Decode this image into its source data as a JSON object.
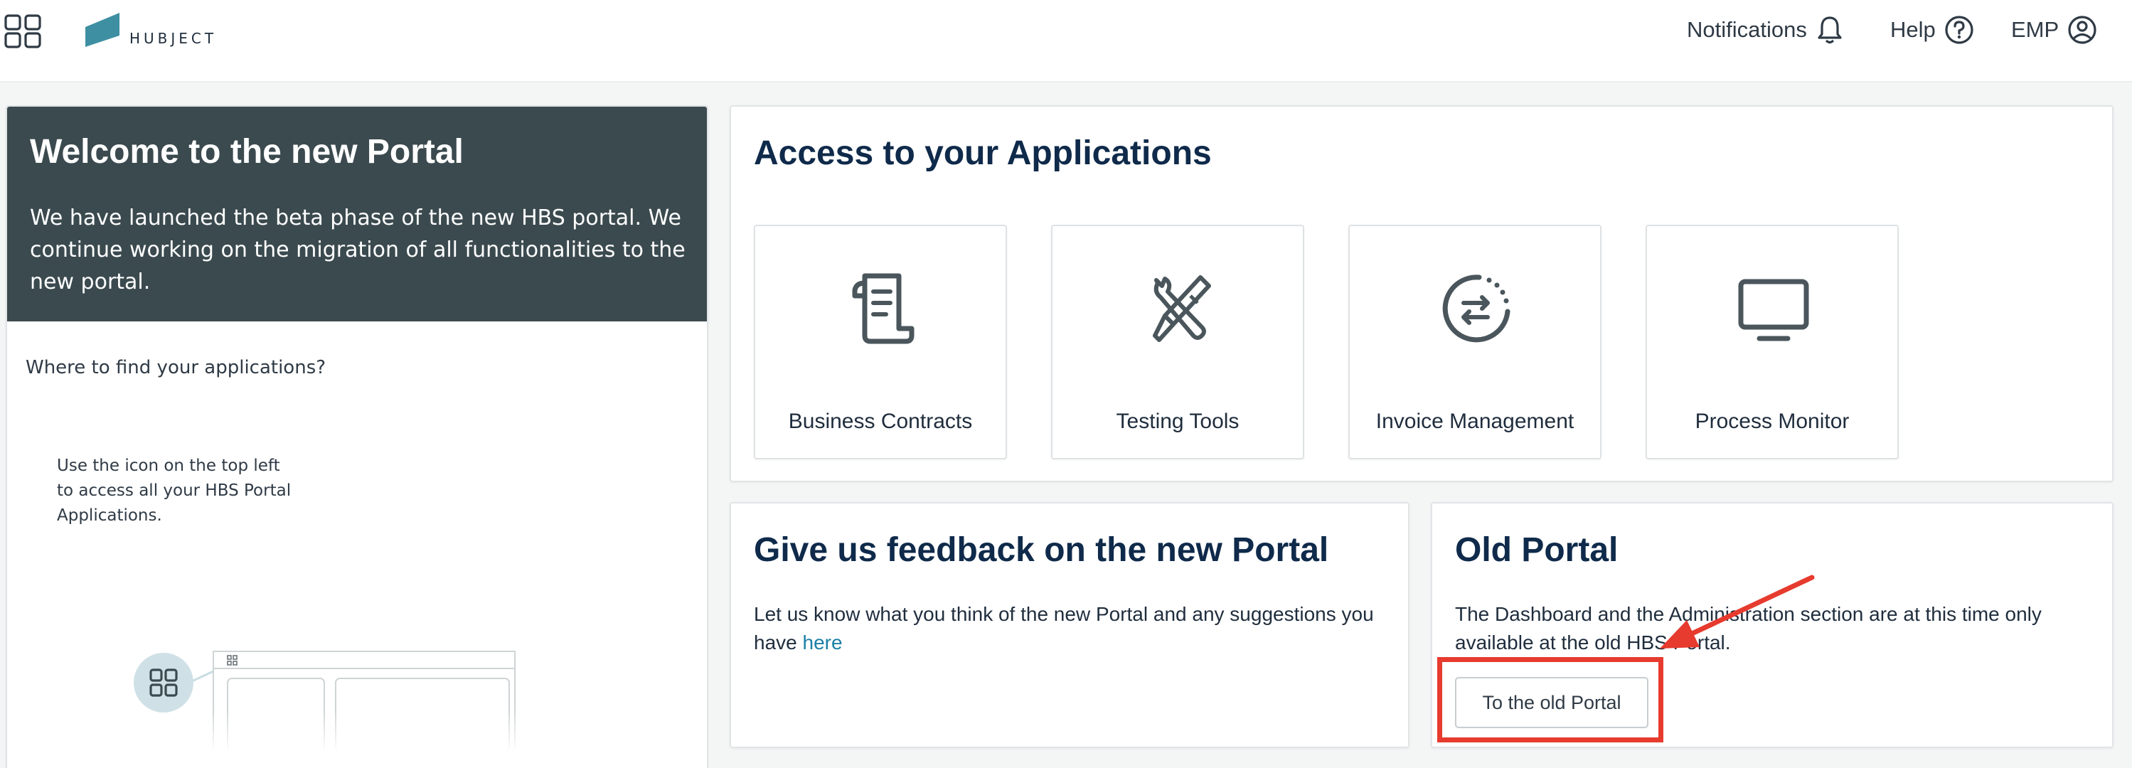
{
  "header": {
    "logo_text": "HUBJECT",
    "notifications_label": "Notifications",
    "help_label": "Help",
    "user_label": "EMP"
  },
  "welcome": {
    "title": "Welcome to the new Portal",
    "text": "We have launched the beta phase of the new HBS portal. We continue working on the migration of all functionalities to the new portal.",
    "find_apps": "Where to find your applications?",
    "use_icon_text": "Use the icon on the top left to access all your HBS Portal Applications."
  },
  "apps": {
    "title": "Access to your Applications",
    "items": [
      {
        "label": "Business Contracts",
        "icon": "contract-scroll-icon"
      },
      {
        "label": "Testing Tools",
        "icon": "tools-icon"
      },
      {
        "label": "Invoice Management",
        "icon": "invoice-exchange-icon"
      },
      {
        "label": "Process Monitor",
        "icon": "monitor-icon"
      }
    ]
  },
  "feedback": {
    "title": "Give us feedback on the new Portal",
    "text": "Let us know what you think of the new Portal and any suggestions you have ",
    "link": "here"
  },
  "old_portal": {
    "title": "Old Portal",
    "text": "The Dashboard and the Administration section are at this time only available at the old HBS Portal.",
    "button_label": "To the old Portal"
  },
  "colors": {
    "welcome_header_bg": "#3b4a4f",
    "title_navy": "#0f2a4a",
    "link": "#1a80a6",
    "logo_teal": "#3f8fa3",
    "annotation_red": "#e63b2e"
  }
}
